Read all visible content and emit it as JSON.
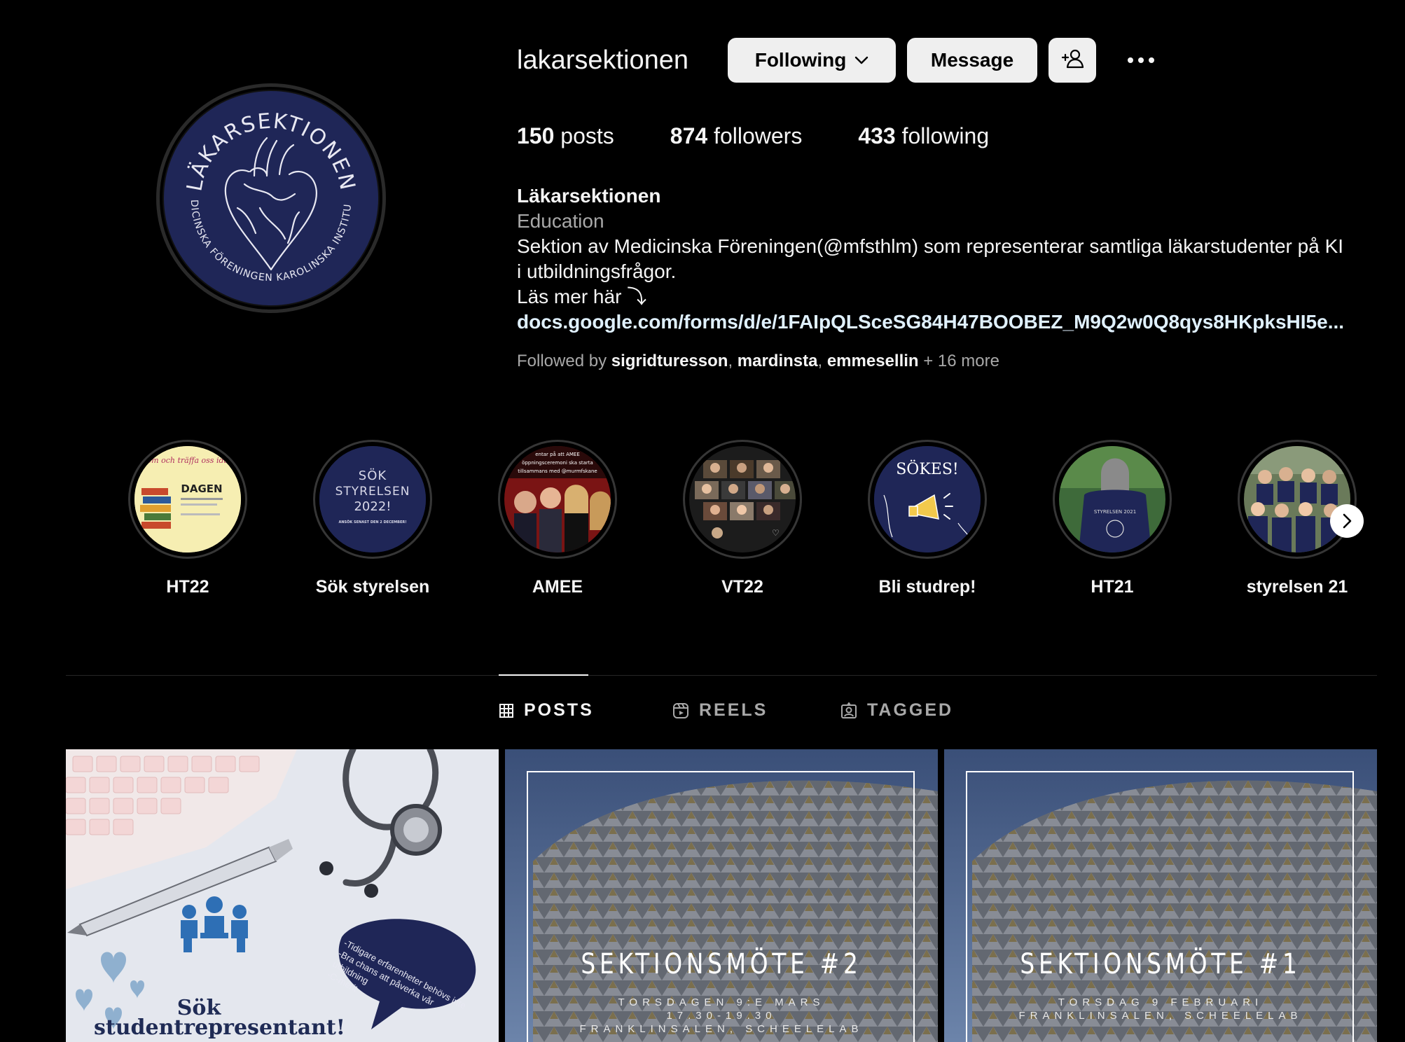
{
  "profile": {
    "username": "lakarsektionen",
    "avatar_alt": "Läkarsektionen logo",
    "avatar_ring_top": "LÄKARSEKTIONEN",
    "avatar_ring_bottom": "MEDICINSKA FÖRENINGEN  KAROLINSKA INSTITUTET"
  },
  "actions": {
    "following_label": "Following",
    "message_label": "Message",
    "add_user_icon": "add-user-icon",
    "more_icon": "more-icon"
  },
  "stats": {
    "posts_count": "150",
    "posts_label": "posts",
    "followers_count": "874",
    "followers_label": "followers",
    "following_count": "433",
    "following_label": "following"
  },
  "bio": {
    "name": "Läkarsektionen",
    "category": "Education",
    "text_line1": "Sektion av Medicinska Föreningen(@mfsthlm) som representerar samtliga läkarstudenter på KI",
    "text_line2": "i utbildningsfrågor.",
    "text_line3": "Läs mer här ⤵",
    "link": "docs.google.com/forms/d/e/1FAIpQLSceSG84H47BOOBEZ_M9Q2w0Q8qys8HKpksHI5e..."
  },
  "followed_by": {
    "prefix": "Followed by",
    "users": [
      "sigridturesson",
      "mardinsta",
      "emmesellin"
    ],
    "more": "+ 16 more"
  },
  "highlights": [
    {
      "label": "HT22",
      "thumb_text": "DAGEN",
      "thumb_top": "kom och träffa oss idag"
    },
    {
      "label": "Sök styrelsen",
      "thumb_text": "SÖK\nSTYRELSEN\n2022!",
      "thumb_sub": "ANSÖK SENAST DEN 2 DECEMBER!"
    },
    {
      "label": "AMEE",
      "thumb_top": "...entar på att AMEE... öppningsceremoni ska starta... tillsammans med @murmfskane"
    },
    {
      "label": "VT22"
    },
    {
      "label": "Bli studrep!",
      "thumb_text": "SÖKES!"
    },
    {
      "label": "HT21",
      "thumb_text": "STYRELSEN 2021"
    },
    {
      "label": "styrelsen 21"
    }
  ],
  "tabs": [
    {
      "label": "POSTS",
      "icon": "grid-icon",
      "active": true
    },
    {
      "label": "REELS",
      "icon": "reels-icon",
      "active": false
    },
    {
      "label": "TAGGED",
      "icon": "tagged-icon",
      "active": false
    }
  ],
  "posts": [
    {
      "title": "Sök\nstudentrepresentant!",
      "bubble_text": "-Tidigare erfarenheter behövs inte\n-Bra chans att påverka vår utbildning\n-C-merit"
    },
    {
      "title": "SEKTIONSMÖTE #2",
      "subtitle": "TORSDAGEN 9:E MARS\n17.30-19.30\nFRANKLINSALEN, SCHEELELAB"
    },
    {
      "title": "SEKTIONSMÖTE #1",
      "subtitle": "TORSDAG 9 FEBRUARI\nFRANKLINSALEN, SCHEELELAB"
    }
  ],
  "colors": {
    "background": "#000000",
    "button_bg": "#efefef",
    "muted_text": "#a8a8a8",
    "link_text": "#e0f1ff",
    "logo_navy": "#1f2657"
  }
}
